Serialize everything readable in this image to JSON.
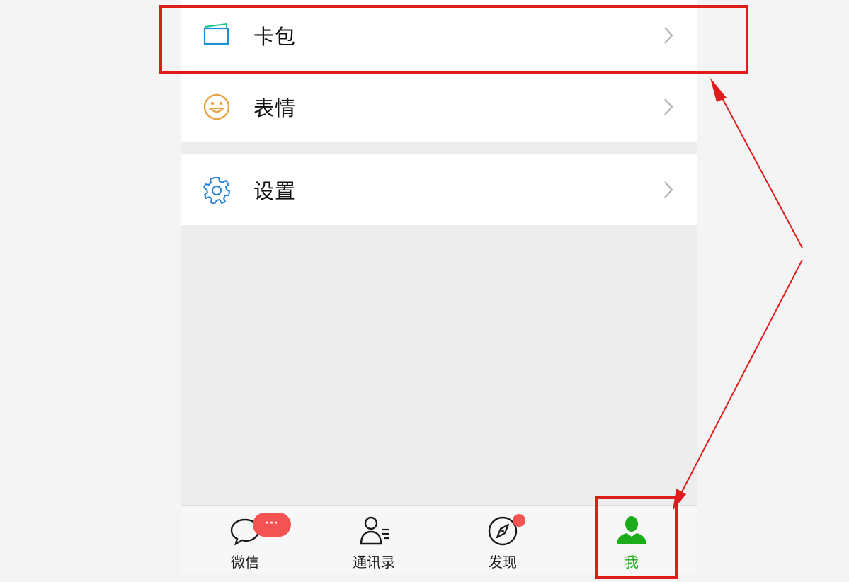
{
  "menu": {
    "items": [
      {
        "label": "卡包",
        "icon": "card-wallet-icon"
      },
      {
        "label": "表情",
        "icon": "smiley-face-icon"
      },
      {
        "label": "设置",
        "icon": "gear-icon"
      }
    ]
  },
  "tabbar": {
    "tabs": [
      {
        "label": "微信",
        "icon": "chat-bubble-icon",
        "badge": "···"
      },
      {
        "label": "通讯录",
        "icon": "contacts-icon"
      },
      {
        "label": "发现",
        "icon": "compass-icon"
      },
      {
        "label": "我",
        "icon": "person-icon",
        "active": true
      }
    ]
  },
  "colors": {
    "accent_green": "#1aad19",
    "badge_red": "#f35353",
    "annotation_red": "#e01b1b",
    "card_icon": "#1e8fd6",
    "emoji_icon": "#e6a340",
    "settings_icon": "#2782d7"
  }
}
